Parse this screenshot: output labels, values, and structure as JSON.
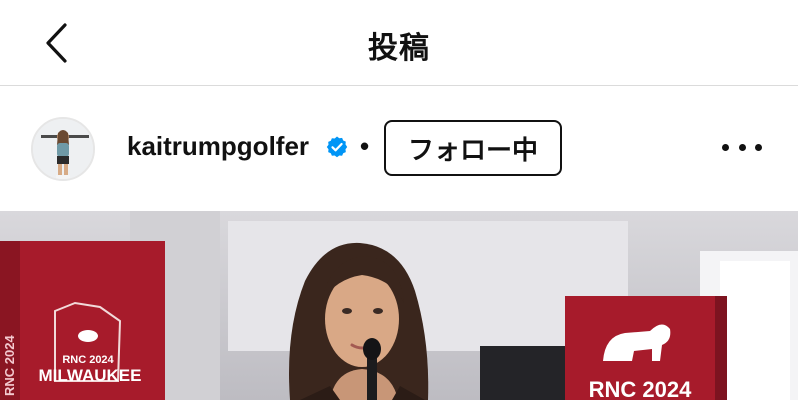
{
  "header": {
    "title": "投稿",
    "back_icon": "chevron-left-icon"
  },
  "post": {
    "username": "kaitrumpgolfer",
    "verified": true,
    "separator": "•",
    "follow_label": "フォロー中",
    "more_icon": "more-horizontal-icon"
  },
  "image": {
    "left_sign_line1": "RNC 2024",
    "left_sign_line2": "MILWAUKEE",
    "left_sign_side": "RNC 2024",
    "right_sign": "RNC 2024",
    "accent": "#b3202f"
  }
}
